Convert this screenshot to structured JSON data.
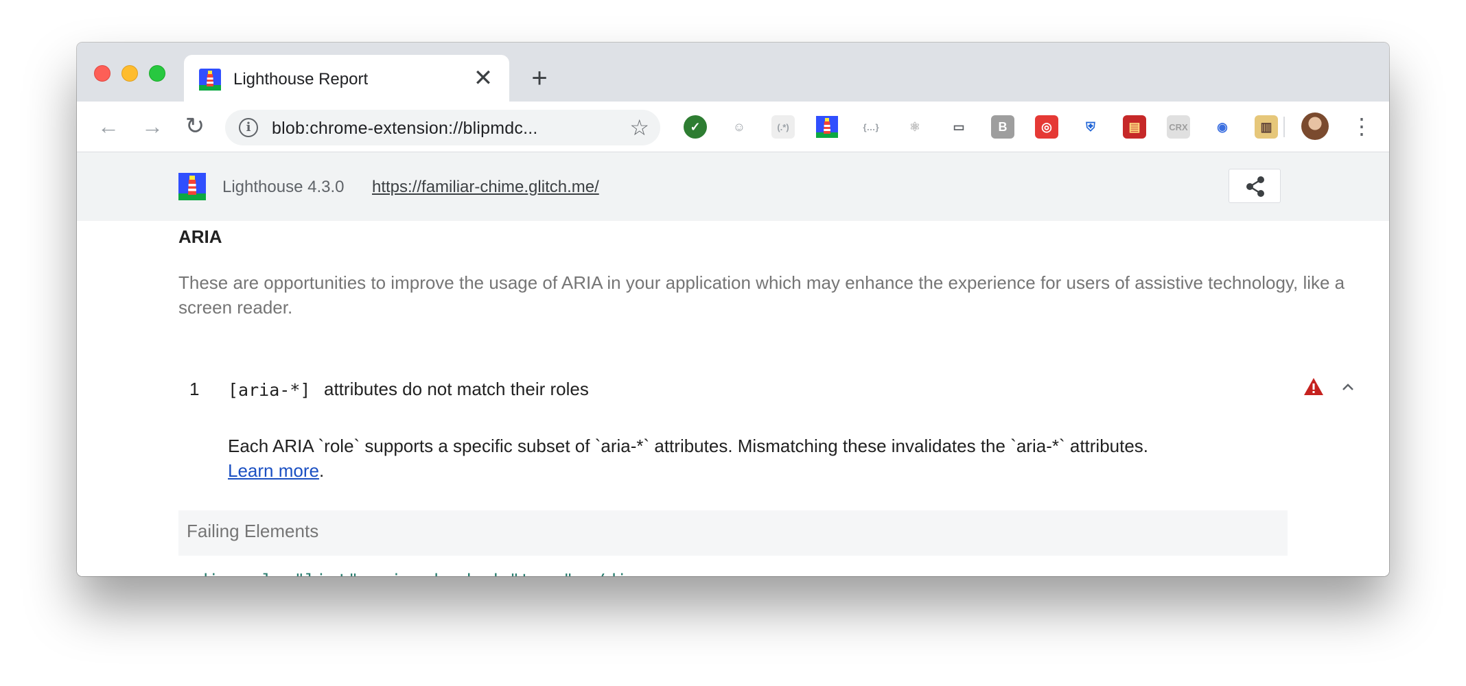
{
  "browser": {
    "tab": {
      "title": "Lighthouse Report",
      "close_glyph": "✕",
      "favicon": "lighthouse-icon"
    },
    "new_tab_glyph": "+",
    "nav": {
      "back_glyph": "←",
      "forward_glyph": "→",
      "reload_glyph": "↻"
    },
    "omnibox": {
      "info_glyph": "i",
      "url": "blob:chrome-extension://blipmdc...",
      "star_glyph": "☆"
    },
    "extensions": [
      {
        "name": "check-badge-icon",
        "glyph": "✓",
        "bg": "#2e7d32",
        "fg": "#ffffff"
      },
      {
        "name": "ghost-icon",
        "glyph": "☺",
        "bg": "#ffffff",
        "fg": "#9aa0a6"
      },
      {
        "name": "regex-icon",
        "glyph": "(.*)",
        "bg": "#eeeeee",
        "fg": "#9aa0a6"
      },
      {
        "name": "lighthouse-ext-icon",
        "glyph": "",
        "bg": "#ffffff",
        "fg": "#000000"
      },
      {
        "name": "json-viewer-icon",
        "glyph": "{…}",
        "bg": "#ffffff",
        "fg": "#9aa0a6"
      },
      {
        "name": "react-icon",
        "glyph": "⚛",
        "bg": "#ffffff",
        "fg": "#bdbdbd"
      },
      {
        "name": "laptop-icon",
        "glyph": "▭",
        "bg": "#ffffff",
        "fg": "#5f6368"
      },
      {
        "name": "b-icon",
        "glyph": "B",
        "bg": "#9e9e9e",
        "fg": "#ffffff"
      },
      {
        "name": "spiral-icon",
        "glyph": "◎",
        "bg": "#e53935",
        "fg": "#ffffff"
      },
      {
        "name": "shield-icon",
        "glyph": "⛨",
        "bg": "#ffffff",
        "fg": "#1e63d6"
      },
      {
        "name": "sd-card-icon",
        "glyph": "▤",
        "bg": "#c62828",
        "fg": "#ffe082"
      },
      {
        "name": "crx-icon",
        "glyph": "CRX",
        "bg": "#e0e0e0",
        "fg": "#9e9e9e"
      },
      {
        "name": "globe-icon",
        "glyph": "◉",
        "bg": "#ffffff",
        "fg": "#3b6fe0"
      },
      {
        "name": "notebook-icon",
        "glyph": "▥",
        "bg": "#e6c77a",
        "fg": "#5d4037"
      }
    ],
    "menu_glyph": "⋮"
  },
  "report": {
    "header": {
      "version": "Lighthouse 4.3.0",
      "url": "https://familiar-chime.glitch.me/"
    },
    "section": {
      "title": "ARIA",
      "description": "These are opportunities to improve the usage of ARIA in your application which may enhance the experience for users of assistive technology, like a screen reader."
    },
    "audit": {
      "index": "1",
      "code": "[aria-*]",
      "title": "attributes do not match their roles",
      "description": "Each ARIA `role` supports a specific subset of `aria-*` attributes. Mismatching these invalidates the `aria-*` attributes.",
      "learn_more": "Learn more",
      "learn_more_suffix": ".",
      "failing_header": "Failing Elements",
      "failing_node": "<div role=\"list\" aria-checked=\"true\"></div>"
    }
  },
  "colors": {
    "fail": "#c5221f",
    "link": "#1a4fc2",
    "node": "#2a7d6f"
  }
}
